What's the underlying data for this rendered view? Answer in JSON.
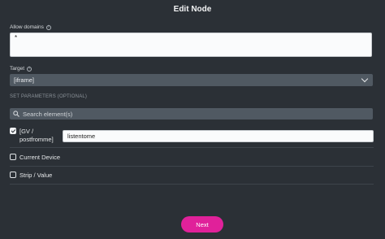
{
  "dialog": {
    "title": "Edit Node"
  },
  "allow_domains": {
    "label": "Allow domains",
    "value": "*"
  },
  "target": {
    "label": "Target",
    "selected": "[iframe]"
  },
  "parameters": {
    "section_label": "SET PARAMETERS (OPTIONAL)",
    "search_placeholder": "Search element(s)",
    "items": [
      {
        "label_line1": "[GV /",
        "label_line2": "postfromme]",
        "checked": true,
        "value": "listentome"
      },
      {
        "label": "Current Device",
        "checked": false
      },
      {
        "label": "Strip / Value",
        "checked": false
      }
    ]
  },
  "footer": {
    "next_label": "Next"
  },
  "colors": {
    "accent": "#e0219a",
    "background": "#2b3036",
    "field": "#505962"
  },
  "icons": {
    "info": "info-icon",
    "search": "search-icon",
    "dropdown": "chevron-down-icon",
    "check": "check-icon"
  }
}
